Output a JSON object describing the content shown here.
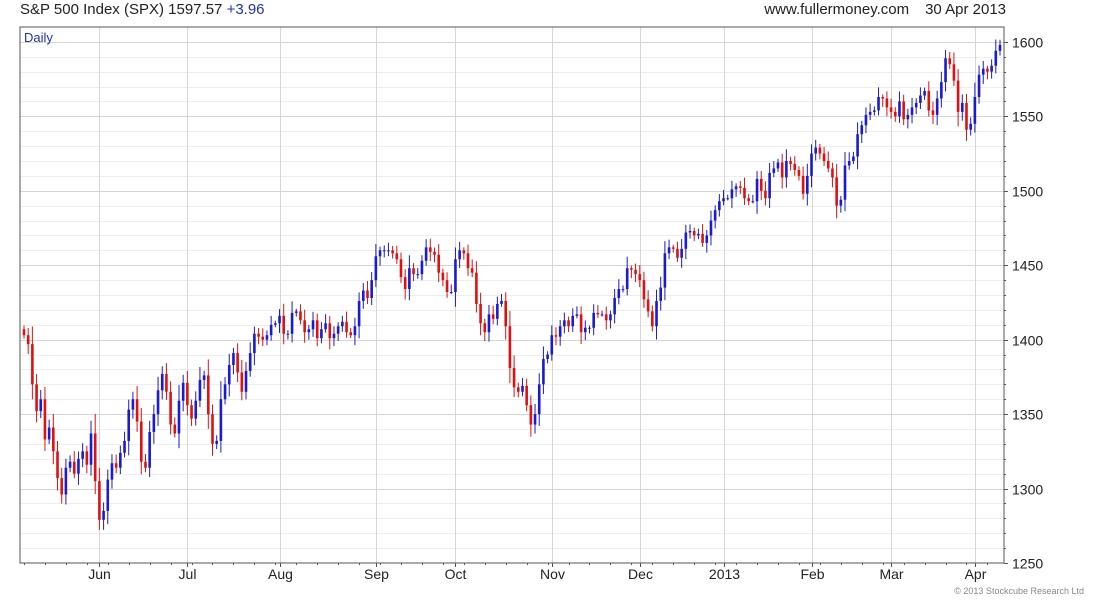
{
  "header": {
    "instrument": "S&P 500 Index (SPX)",
    "last": "1597.57",
    "change": "+3.96",
    "site": "www.fullermoney.com",
    "date": "30 Apr 2013"
  },
  "footer": {
    "copyright": "© 2013 Stockcube Research Ltd"
  },
  "colors": {
    "up": "#1a1ad0",
    "down": "#e01010",
    "grid": "#d6d6d6",
    "grid_minor": "#eeeeee",
    "axis": "#555555",
    "text": "#222222",
    "accent": "#2233aa"
  },
  "chart_data": {
    "type": "candlestick",
    "period_label": "Daily",
    "y_axis": {
      "position": "right",
      "min": 1250,
      "max": 1600,
      "ticks": [
        1250,
        1300,
        1350,
        1400,
        1450,
        1500,
        1550,
        1600
      ]
    },
    "grid": true,
    "months": [
      {
        "label": "Jun",
        "index": 18
      },
      {
        "label": "Jul",
        "index": 39
      },
      {
        "label": "Aug",
        "index": 61
      },
      {
        "label": "Sep",
        "index": 84
      },
      {
        "label": "Oct",
        "index": 103
      },
      {
        "label": "Nov",
        "index": 126
      },
      {
        "label": "Dec",
        "index": 147
      },
      {
        "label": "2013",
        "index": 167
      },
      {
        "label": "Feb",
        "index": 188
      },
      {
        "label": "Mar",
        "index": 207
      },
      {
        "label": "Apr",
        "index": 227
      }
    ],
    "closes": [
      1403,
      1397,
      1370,
      1352,
      1360,
      1333,
      1341,
      1325,
      1307,
      1296,
      1314,
      1318,
      1310,
      1320,
      1325,
      1316,
      1337,
      1305,
      1279,
      1285,
      1306,
      1317,
      1314,
      1324,
      1332,
      1353,
      1360,
      1345,
      1318,
      1314,
      1338,
      1350,
      1366,
      1377,
      1365,
      1343,
      1337,
      1359,
      1371,
      1356,
      1347,
      1359,
      1373,
      1376,
      1350,
      1330,
      1332,
      1360,
      1370,
      1383,
      1391,
      1378,
      1365,
      1379,
      1391,
      1404,
      1402,
      1400,
      1403,
      1410,
      1411,
      1416,
      1404,
      1404,
      1418,
      1419,
      1413,
      1405,
      1407,
      1413,
      1401,
      1407,
      1411,
      1401,
      1404,
      1409,
      1412,
      1405,
      1403,
      1409,
      1426,
      1433,
      1428,
      1440,
      1456,
      1460,
      1460,
      1460,
      1458,
      1454,
      1442,
      1434,
      1448,
      1444,
      1444,
      1453,
      1462,
      1459,
      1457,
      1445,
      1440,
      1432,
      1432,
      1454,
      1460,
      1458,
      1448,
      1445,
      1424,
      1411,
      1405,
      1417,
      1414,
      1424,
      1426,
      1409,
      1381,
      1368,
      1365,
      1369,
      1356,
      1343,
      1350,
      1370,
      1387,
      1390,
      1403,
      1402,
      1409,
      1413,
      1409,
      1416,
      1417,
      1405,
      1408,
      1408,
      1418,
      1417,
      1417,
      1413,
      1417,
      1428,
      1434,
      1434,
      1448,
      1447,
      1444,
      1440,
      1427,
      1419,
      1409,
      1426,
      1435,
      1458,
      1462,
      1461,
      1455,
      1461,
      1472,
      1473,
      1470,
      1471,
      1465,
      1470,
      1480,
      1487,
      1493,
      1495,
      1495,
      1501,
      1503,
      1502,
      1495,
      1493,
      1493,
      1508,
      1500,
      1495,
      1512,
      1515,
      1519,
      1509,
      1520,
      1518,
      1514,
      1510,
      1498,
      1510,
      1525,
      1529,
      1525,
      1520,
      1515,
      1509,
      1490,
      1494,
      1517,
      1520,
      1523,
      1538,
      1544,
      1551,
      1553,
      1554,
      1563,
      1562,
      1556,
      1553,
      1550,
      1560,
      1548,
      1551,
      1556,
      1559,
      1564,
      1567,
      1554,
      1551,
      1562,
      1573,
      1589,
      1585,
      1574,
      1553,
      1559,
      1541,
      1545,
      1563,
      1578,
      1582,
      1580,
      1584,
      1594,
      1598
    ]
  }
}
